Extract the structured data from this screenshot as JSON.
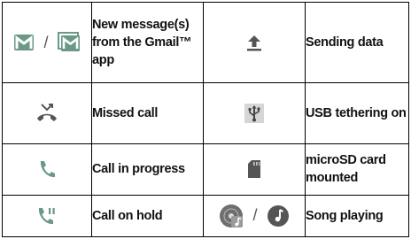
{
  "rows": [
    {
      "left_icon": [
        "gmail-icon",
        "gmail-multiple-icon"
      ],
      "left_separator": "/",
      "left_label": "New message(s) from the Gmail™ app",
      "right_icon": [
        "upload-arrow-icon"
      ],
      "right_label": "Sending data"
    },
    {
      "left_icon": [
        "missed-call-icon"
      ],
      "left_label": "Missed call",
      "right_icon": [
        "usb-icon"
      ],
      "right_label": "USB tethering on"
    },
    {
      "left_icon": [
        "phone-icon"
      ],
      "left_label": "Call in progress",
      "right_icon": [
        "sd-card-icon"
      ],
      "right_label": "microSD card mounted"
    },
    {
      "left_icon": [
        "call-hold-icon"
      ],
      "left_label": "Call on hold",
      "right_icon": [
        "music-app-icon",
        "music-note-circle-icon"
      ],
      "right_separator": "/",
      "right_label": "Song playing"
    }
  ],
  "colors": {
    "gmail": "#6a9a86",
    "phone": "#6a9a86",
    "gray_icon": "#555555",
    "border": "#000000"
  }
}
